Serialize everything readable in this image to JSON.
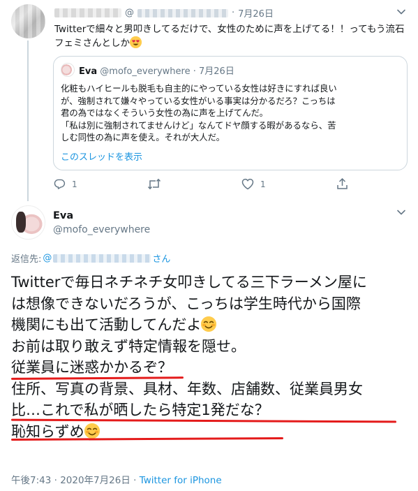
{
  "first_tweet": {
    "handle_prefix": "@",
    "date": "7月26日",
    "separator": "·",
    "text": "Twitterで細々と男叩きしてるだけで、女性のために声を上げてる！！ってもう流石フェミさんとしか",
    "emoji": "heart-eyes",
    "quote": {
      "name": "Eva",
      "handle": "@mofo_everywhere",
      "separator": "·",
      "date": "7月26日",
      "lines": [
        "化粧もハイヒールも脱毛も自主的にやっている女性は好きにすれば良い",
        "が、強制されて嫌々やっている女性がいる事実は分かるだろ？こっちは",
        "君の為ではなくそういう女性の為に声を上げてんだ。",
        "「私は別に強制されてませんけど」なんてドヤ顔する暇があるなら、苦",
        "しむ同性の為に声を使え。それが大人だ。"
      ],
      "thread_link": "このスレッドを表示"
    },
    "actions": {
      "reply_count": "1",
      "retweet_count": "",
      "like_count": "1"
    }
  },
  "main_tweet": {
    "name": "Eva",
    "handle": "@mofo_everywhere",
    "reply_label": "返信先: ",
    "reply_at": "@",
    "reply_suffix": "さん",
    "lines": [
      "Twitterで毎日ネチネチ女叩きしてる三下ラーメン屋に",
      "は想像できないだろうが、こっちは学生時代から国際",
      "機関にも出て活動してんだよ",
      "お前は取り敢えず特定情報を隠せ。",
      "従業員に迷惑かかるぞ？",
      "",
      "住所、写真の背景、具材、年数、店舗数、従業員男女",
      "比…これで私が晒したら特定1発だな？",
      "恥知らずめ"
    ],
    "emoji": "smiling-blush",
    "timestamp": "午後7:43 · 2020年7月26日 · ",
    "source": "Twitter for iPhone"
  },
  "colors": {
    "link": "#1b95e0",
    "muted": "#657786",
    "border": "#ccd6dd",
    "underline": "#e41b1b",
    "emoji": "#ffcc4d"
  }
}
